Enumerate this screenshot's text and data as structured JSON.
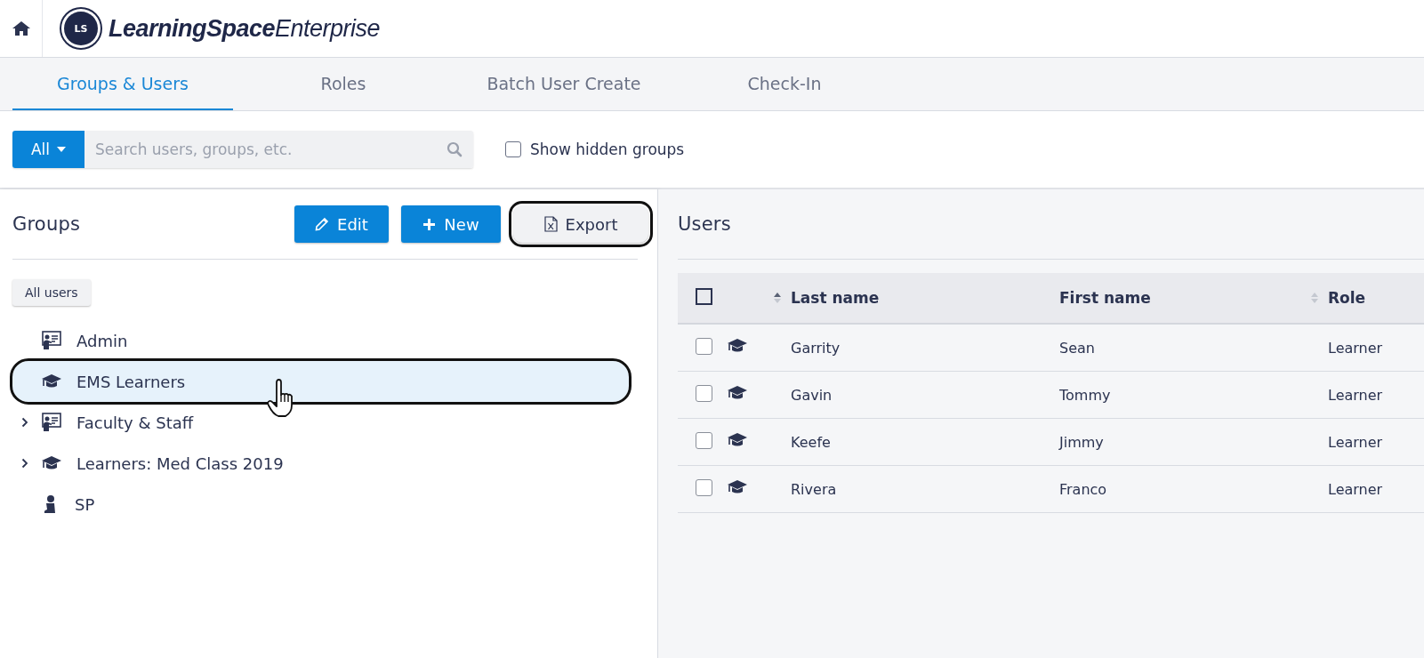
{
  "header": {
    "logo": {
      "mark": "LS",
      "name": "LearningSpace",
      "suffix": "Enterprise"
    }
  },
  "tabs": [
    {
      "label": "Groups & Users",
      "selected": true
    },
    {
      "label": "Roles",
      "selected": false
    },
    {
      "label": "Batch User Create",
      "selected": false
    },
    {
      "label": "Check-In",
      "selected": false
    }
  ],
  "filter": {
    "scope": "All",
    "placeholder": "Search users, groups, etc.",
    "show_hidden": {
      "label": "Show hidden groups",
      "checked": false
    }
  },
  "groups": {
    "title": "Groups",
    "buttons": [
      {
        "label": "Edit",
        "kind": "edit",
        "highlighted": false
      },
      {
        "label": "New",
        "kind": "new",
        "highlighted": false
      },
      {
        "label": "Export",
        "kind": "export",
        "highlighted": true
      }
    ],
    "all_users": "All users",
    "items": [
      {
        "label": "Admin",
        "kind": "presenter",
        "expandable": false,
        "selected": false
      },
      {
        "label": "EMS Learners",
        "kind": "cap",
        "expandable": false,
        "selected": true
      },
      {
        "label": "Faculty & Staff",
        "kind": "presenter",
        "expandable": true,
        "selected": false
      },
      {
        "label": "Learners: Med Class 2019",
        "kind": "cap",
        "expandable": true,
        "selected": false
      },
      {
        "label": "SP",
        "kind": "person",
        "expandable": false,
        "selected": false
      }
    ]
  },
  "users": {
    "title": "Users",
    "select_all": {
      "checked": false
    },
    "columns": [
      {
        "label": "Last name",
        "sortable": true,
        "sorted": true
      },
      {
        "label": "First name",
        "sortable": false
      },
      {
        "label": "Role",
        "sortable": true,
        "sorted": false
      }
    ],
    "rows": [
      {
        "checked": false,
        "kind": "cap",
        "cells": [
          "Garrity",
          "Sean",
          "Learner"
        ]
      },
      {
        "checked": false,
        "kind": "cap",
        "cells": [
          "Gavin",
          "Tommy",
          "Learner"
        ]
      },
      {
        "checked": false,
        "kind": "cap",
        "cells": [
          "Keefe",
          "Jimmy",
          "Learner"
        ]
      },
      {
        "checked": false,
        "kind": "cap",
        "cells": [
          "Rivera",
          "Franco",
          "Learner"
        ]
      }
    ]
  }
}
